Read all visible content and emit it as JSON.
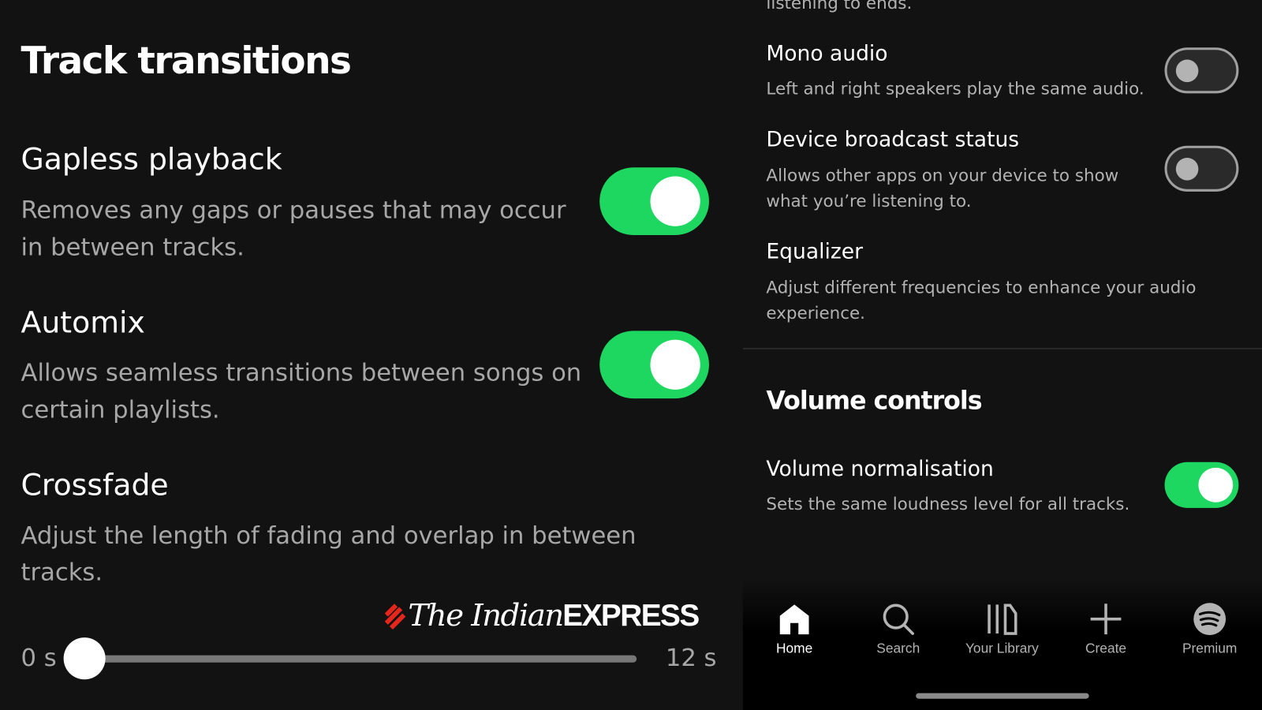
{
  "left": {
    "section_title": "Track transitions",
    "settings": [
      {
        "title": "Gapless playback",
        "description": "Removes any gaps or pauses that may occur in between tracks.",
        "enabled": true
      },
      {
        "title": "Automix",
        "description": "Allows seamless transitions between songs on certain playlists.",
        "enabled": true
      },
      {
        "title": "Crossfade",
        "description": "Adjust the length of fading and overlap in between tracks."
      }
    ],
    "crossfade_slider": {
      "min_label": "0 s",
      "max_label": "12 s",
      "value_seconds": 0
    }
  },
  "watermark": {
    "part1": "The Indian",
    "part2": "EXPRESS"
  },
  "right": {
    "cut_text": "listening to ends.",
    "settings": [
      {
        "title": "Mono audio",
        "description": "Left and right speakers play the same audio.",
        "enabled": false
      },
      {
        "title": "Device broadcast status",
        "description": "Allows other apps on your device to show what you’re listening to.",
        "enabled": false
      },
      {
        "title": "Equalizer",
        "description": "Adjust different frequencies to enhance your audio experience."
      }
    ],
    "volume_section_title": "Volume controls",
    "volume_normalisation": {
      "title": "Volume normalisation",
      "description": "Sets the same loudness level for all tracks.",
      "enabled": true
    }
  },
  "nav": {
    "items": [
      {
        "label": "Home",
        "icon": "home-icon",
        "active": true
      },
      {
        "label": "Search",
        "icon": "search-icon"
      },
      {
        "label": "Your Library",
        "icon": "library-icon"
      },
      {
        "label": "Create",
        "icon": "plus-icon"
      },
      {
        "label": "Premium",
        "icon": "spotify-icon"
      }
    ]
  },
  "colors": {
    "accent": "#1ed760",
    "background": "#121212",
    "watermark_red": "#e4261c"
  }
}
